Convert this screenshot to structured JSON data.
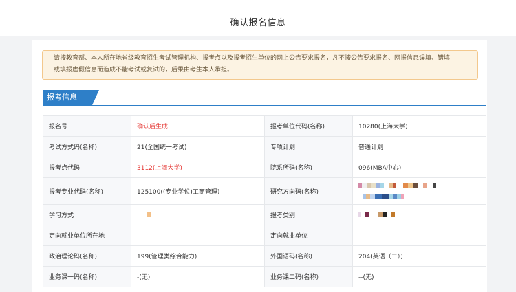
{
  "page": {
    "title": "确认报名信息"
  },
  "notice": {
    "line1": "请按教育部、本人所在地省级教育招生考试管理机构、报考点以及报考招生单位的网上公告要求报名，凡不按公告要求报名、网报信息误填、错填",
    "line2": "或填报虚假信息而造成不能考试或复试的，后果由考生本人承担。"
  },
  "section": {
    "title": "报考信息"
  },
  "rows": [
    {
      "l1": "报名号",
      "v1": "确认后生成",
      "l2": "报考单位代码(名称)",
      "v2": "10280(上海大学)"
    },
    {
      "l1": "考试方式码(名称)",
      "v1": "21(全国统一考试)",
      "l2": "专项计划",
      "v2": "普通计划"
    },
    {
      "l1": "报考点代码",
      "v1": "3112(上海大学)",
      "l2": "院系所码(名称)",
      "v2": "096(MBA中心)"
    },
    {
      "l1": "报考专业代码(名称)",
      "v1": "125100((专业学位)工商管理)",
      "l2": "研究方向码(名称)",
      "v2": ""
    },
    {
      "l1": "学习方式",
      "v1": "",
      "l2": "报考类别",
      "v2": ""
    },
    {
      "l1": "定向就业单位所在地",
      "v1": "",
      "l2": "定向就业单位",
      "v2": ""
    },
    {
      "l1": "政治理论码(名称)",
      "v1": "199(管理类综合能力)",
      "l2": "外国语码(名称)",
      "v2": "204(英语（二）)"
    },
    {
      "l1": "业务课一码(名称)",
      "v1": "-(无)",
      "l2": "业务课二码(名称)",
      "v2": "--(无)"
    }
  ],
  "colors": {
    "accent": "#2e7fc8",
    "highlight": "#e53935",
    "notice_bg": "#fcf3e3",
    "notice_border": "#f3c88d"
  }
}
